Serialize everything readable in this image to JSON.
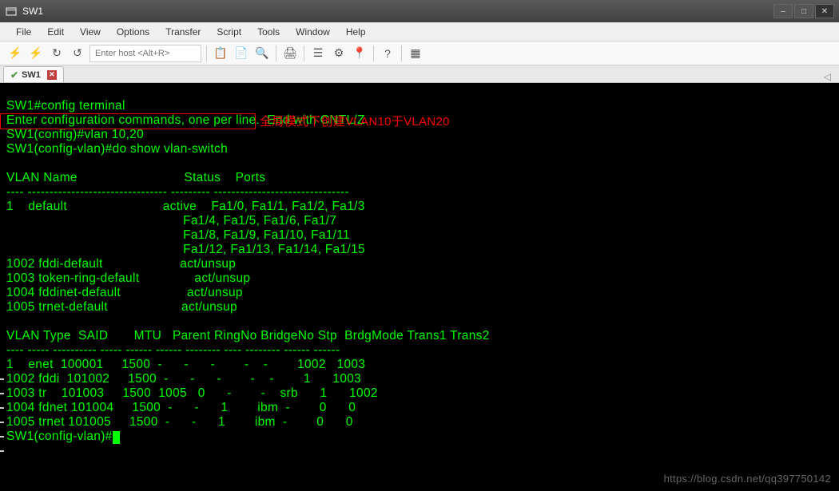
{
  "window": {
    "title": "SW1",
    "buttons": {
      "min": "–",
      "max": "□",
      "close": "✕"
    }
  },
  "menubar": {
    "items": [
      "File",
      "Edit",
      "View",
      "Options",
      "Transfer",
      "Script",
      "Tools",
      "Window",
      "Help"
    ]
  },
  "toolbar": {
    "host_placeholder": "Enter host <Alt+R>"
  },
  "tabbar": {
    "tab_label": "SW1",
    "close_x": "✕",
    "right_arrow": "◁"
  },
  "annotation": {
    "text": "全局模式下创建VLAN10于VLAN20"
  },
  "terminal": {
    "lines": [
      "SW1#config terminal",
      "Enter configuration commands, one per line.  End with CNTL/Z.",
      "SW1(config)#vlan 10,20",
      "SW1(config-vlan)#do show vlan-switch",
      "",
      "VLAN Name                             Status    Ports",
      "---- -------------------------------- --------- -------------------------------",
      "1    default                          active    Fa1/0, Fa1/1, Fa1/2, Fa1/3",
      "                                                Fa1/4, Fa1/5, Fa1/6, Fa1/7",
      "                                                Fa1/8, Fa1/9, Fa1/10, Fa1/11",
      "                                                Fa1/12, Fa1/13, Fa1/14, Fa1/15",
      "1002 fddi-default                     act/unsup ",
      "1003 token-ring-default               act/unsup ",
      "1004 fddinet-default                  act/unsup ",
      "1005 trnet-default                    act/unsup ",
      "",
      "VLAN Type  SAID       MTU   Parent RingNo BridgeNo Stp  BrdgMode Trans1 Trans2",
      "---- ----- ---------- ----- ------ ------ -------- ---- -------- ------ ------",
      "1    enet  100001     1500  -      -      -        -    -        1002   1003",
      "1002 fddi  101002     1500  -      -      -        -    -        1      1003",
      "1003 tr    101003     1500  1005   0      -        -    srb      1      1002",
      "1004 fdnet 101004     1500  -      -      1        ibm  -        0      0",
      "1005 trnet 101005     1500  -      -      1        ibm  -        0      0"
    ],
    "prompt": "SW1(config-vlan)#"
  },
  "watermark": "https://blog.csdn.net/qq397750142"
}
